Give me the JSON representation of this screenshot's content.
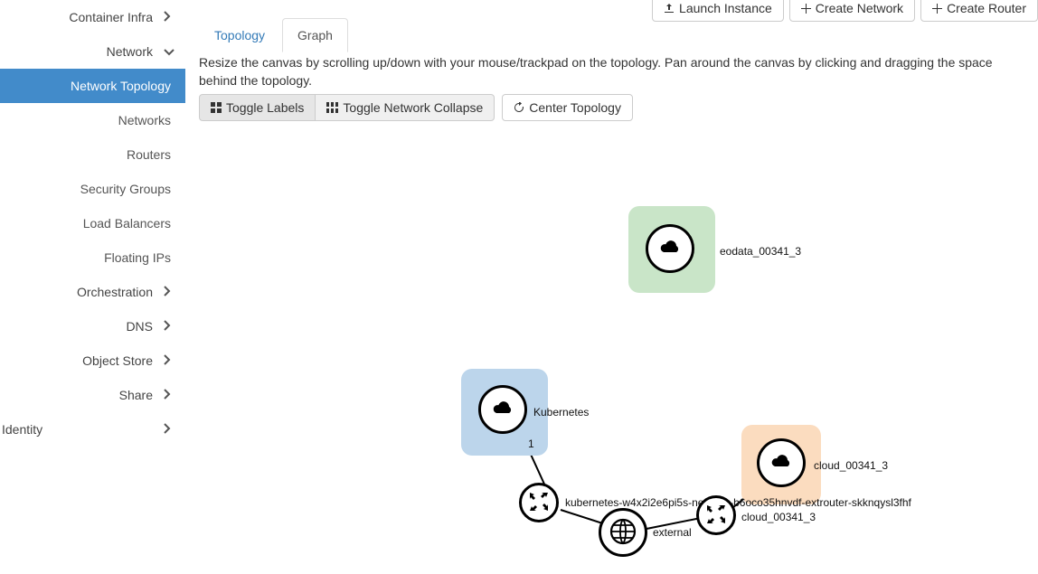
{
  "sidebar": {
    "items": [
      {
        "label": "Container Infra",
        "expandable": true,
        "open": false
      },
      {
        "label": "Network",
        "expandable": true,
        "open": true
      },
      {
        "label": "Orchestration",
        "expandable": true,
        "open": false
      },
      {
        "label": "DNS",
        "expandable": true,
        "open": false
      },
      {
        "label": "Object Store",
        "expandable": true,
        "open": false
      },
      {
        "label": "Share",
        "expandable": true,
        "open": false
      }
    ],
    "network_sub": [
      {
        "label": "Network Topology",
        "active": true
      },
      {
        "label": "Networks",
        "active": false
      },
      {
        "label": "Routers",
        "active": false
      },
      {
        "label": "Security Groups",
        "active": false
      },
      {
        "label": "Load Balancers",
        "active": false
      },
      {
        "label": "Floating IPs",
        "active": false
      }
    ],
    "identity_label": "Identity"
  },
  "top_buttons": {
    "launch": "Launch Instance",
    "create_net": "Create Network",
    "create_router": "Create Router"
  },
  "tabs": {
    "topology": "Topology",
    "graph": "Graph"
  },
  "help_text": "Resize the canvas by scrolling up/down with your mouse/trackpad on the topology. Pan around the canvas by clicking and dragging the space behind the topology.",
  "toolbar": {
    "toggle_labels": "Toggle Labels",
    "toggle_collapse": "Toggle Network Collapse",
    "center": "Center Topology"
  },
  "topology": {
    "nodes": {
      "eodata": {
        "label": "eodata_00341_3"
      },
      "kubernetes": {
        "label": "Kubernetes",
        "badge": "1"
      },
      "cloud": {
        "label": "cloud_00341_3"
      },
      "router_k8s": {
        "label": "kubernetes-w4x2i2e6pi5s-network-b6oco35hnvdf-extrouter-skknqysl3fhf"
      },
      "external": {
        "label": "external"
      },
      "router_cloud": {
        "label": "cloud_00341_3"
      }
    }
  }
}
